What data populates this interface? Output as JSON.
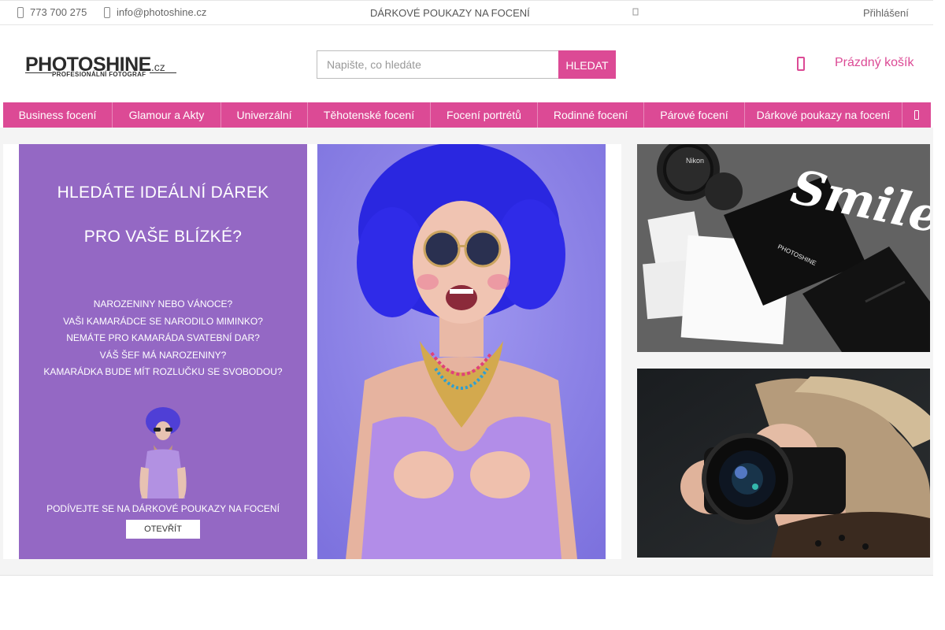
{
  "topbar": {
    "phone": "773 700 275",
    "email": "info@photoshine.cz",
    "promo": "DÁRKOVÉ POUKAZY NA FOCENÍ",
    "login": "Přihlášení"
  },
  "header": {
    "logo_brand": "PHOTOSHINE",
    "logo_tld": ".cz",
    "logo_sub": "PROFESIONÁLNÍ FOTOGRAF",
    "search_placeholder": "Napište, co hledáte",
    "search_button": "HLEDAT",
    "cart_label": "Prázdný košík"
  },
  "nav": {
    "items": [
      "Business focení",
      "Glamour a Akty",
      "Univerzální",
      "Těhotenské focení",
      "Focení portrétů",
      "Rodinné focení",
      "Párové focení",
      "Dárkové poukazy na focení"
    ]
  },
  "banner": {
    "heading1": "HLEDÁTE IDEÁLNÍ DÁREK",
    "heading2": "PRO VAŠE BLÍZKÉ?",
    "questions": [
      "NAROZENINY NEBO VÁNOCE?",
      "VAŠI KAMARÁDCE SE NARODILO MIMINKO?",
      "NEMÁTE PRO KAMARÁDA SVATEBNÍ DAR?",
      "VÁŠ ŠEF MÁ NAROZENINY?",
      "KAMARÁDKA BUDE MÍT ROZLUČKU SE SVOBODOU?"
    ],
    "cta": "PODÍVEJTE SE NA DÁRKOVÉ POUKAZY NA FOCENÍ",
    "button": "OTEVŘÍT"
  },
  "kit_photo": {
    "smile_text": "Smile",
    "lens_brand": "Nikon",
    "card_brand": "PHOTOSHINE"
  },
  "colors": {
    "brand_pink": "#dc4a95",
    "promo_purple": "#9468c4",
    "photo_bg": "#8d84e8"
  }
}
